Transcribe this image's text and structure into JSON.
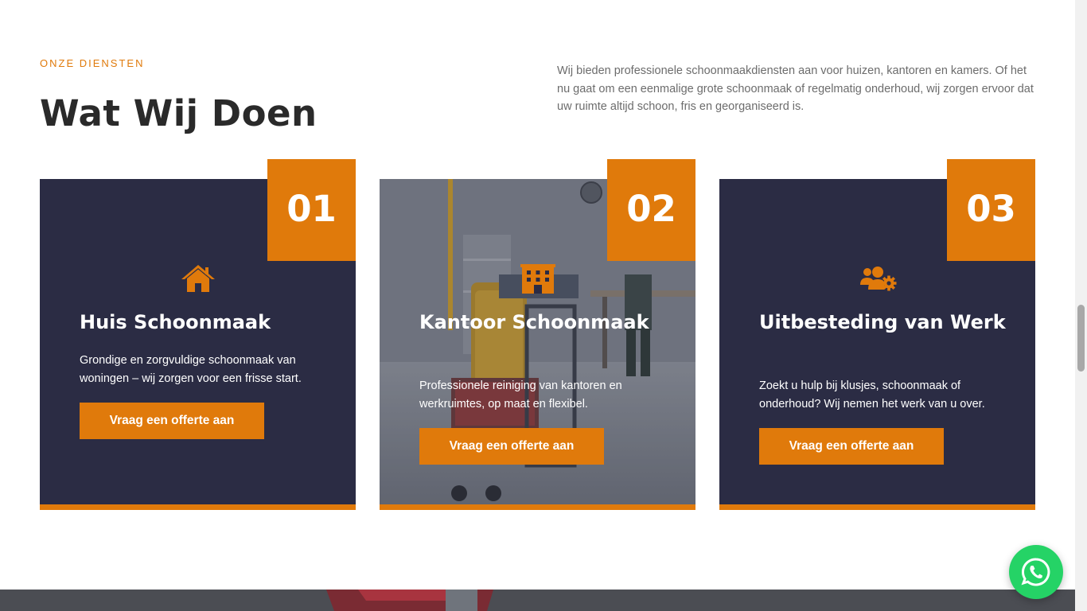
{
  "section": {
    "eyebrow": "ONZE DIENSTEN",
    "heading": "Wat Wij Doen",
    "intro": "Wij bieden professionele schoonmaakdiensten aan voor huizen, kantoren en kamers. Of het nu gaat om een eenmalige grote schoonmaak of regelmatig onderhoud, wij zorgen ervoor dat uw ruimte altijd schoon, fris en georganiseerd is."
  },
  "cards": [
    {
      "number": "01",
      "icon": "house-icon",
      "title": "Huis Schoonmaak",
      "description": "Grondige en zorgvuldige schoonmaak van woningen – wij zorgen voor een frisse start.",
      "button": "Vraag een offerte aan"
    },
    {
      "number": "02",
      "icon": "office-building-icon",
      "title": "Kantoor Schoonmaak",
      "description": "Professionele reiniging van kantoren en werkruimtes, op maat en flexibel.",
      "button": "Vraag een offerte aan"
    },
    {
      "number": "03",
      "icon": "users-gear-icon",
      "title": "Uitbesteding van Werk",
      "description": "Zoekt u hulp bij klusjes, schoonmaak of onderhoud? Wij nemen het werk van u over.",
      "button": "Vraag een offerte aan"
    }
  ],
  "floating": {
    "whatsapp_icon": "whatsapp-icon"
  },
  "colors": {
    "accent": "#e07a0b",
    "card_bg": "#2b2c44",
    "whatsapp": "#25d366"
  }
}
